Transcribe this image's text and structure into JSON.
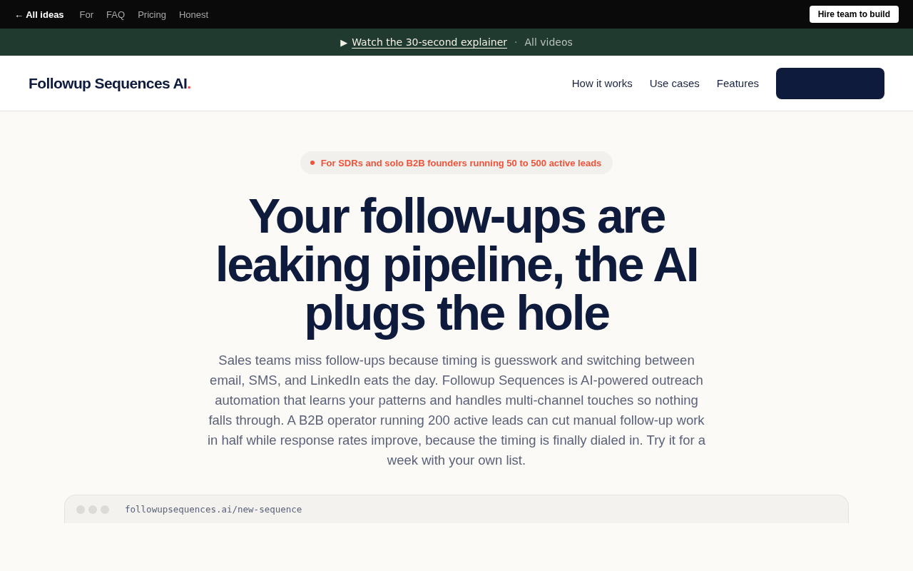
{
  "top_bar": {
    "back_link": "← All ideas",
    "links": [
      "For",
      "FAQ",
      "Pricing",
      "Honest"
    ],
    "button": "Hire team to build"
  },
  "video_banner": {
    "play_icon": "▶",
    "link": "Watch the 30-second explainer",
    "separator": "·",
    "secondary_link": "All videos"
  },
  "header": {
    "logo": "Followup Sequences AI",
    "logo_mark": ".",
    "nav": [
      "How it works",
      "Use cases",
      "Features"
    ]
  },
  "hero": {
    "badge": "For SDRs and solo B2B founders running 50 to 500 active leads",
    "headline": "Your follow-ups are leaking pipeline, the AI plugs the hole",
    "description": "Sales teams miss follow-ups because timing is guesswork and switching between email, SMS, and LinkedIn eats the day. Followup Sequences is AI-powered outreach automation that learns your patterns and handles multi-channel touches so nothing falls through. A B2B operator running 200 active leads can cut manual follow-up work in half while response rates improve, because the timing is finally dialed in. Try it for a week with your own list."
  },
  "browser_preview": {
    "url": "followupsequences.ai/new-sequence"
  }
}
